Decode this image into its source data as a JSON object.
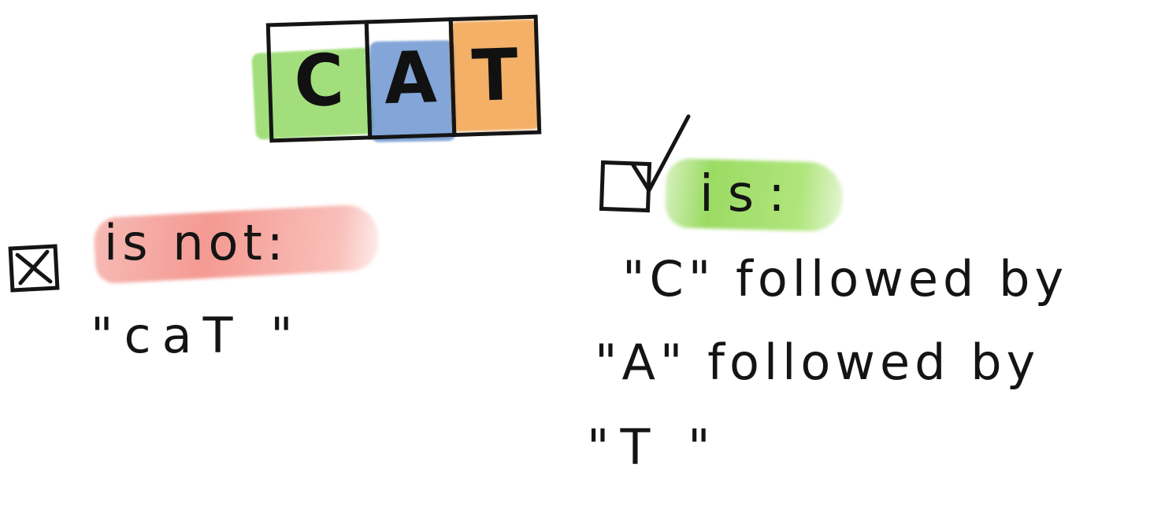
{
  "word": {
    "letters": [
      "C",
      "A",
      "T"
    ],
    "colors": [
      "#7fd24a",
      "#4a7cc4",
      "#f0922e"
    ]
  },
  "not_section": {
    "label": "is not:",
    "example": "\"caT \"",
    "highlight_color": "#f08a80"
  },
  "is_section": {
    "label": "is:",
    "lines": [
      "\"C\" followed by",
      "\"A\" followed by",
      "\"T \""
    ],
    "highlight_color": "#8fd65a"
  },
  "icons": {
    "not_checkbox": "crossed-checkbox-icon",
    "is_checkbox": "checked-checkbox-icon"
  }
}
